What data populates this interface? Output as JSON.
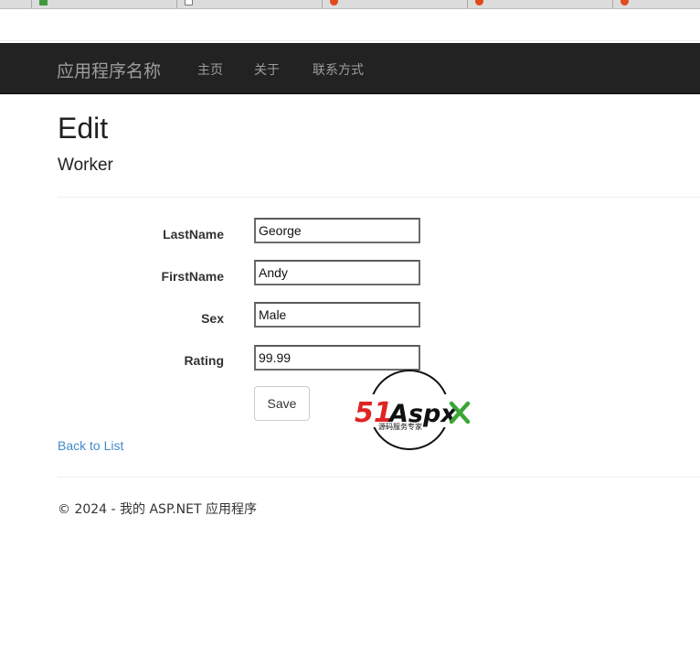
{
  "navbar": {
    "brand": "应用程序名称",
    "links": [
      "主页",
      "关于",
      "联系方式"
    ]
  },
  "page": {
    "title": "Edit",
    "subtitle": "Worker"
  },
  "form": {
    "fields": [
      {
        "label": "LastName",
        "value": "George"
      },
      {
        "label": "FirstName",
        "value": "Andy"
      },
      {
        "label": "Sex",
        "value": "Male"
      },
      {
        "label": "Rating",
        "value": "99.99"
      }
    ],
    "save_label": "Save"
  },
  "back_link": "Back to List",
  "footer": "© 2024 - 我的 ASP.NET 应用程序",
  "watermark": {
    "brand_51": "51",
    "brand_aspx": "Aspx",
    "tagline": "源码服务专家"
  },
  "colors": {
    "navbar_bg": "#222222",
    "nav_text": "#9d9d9d",
    "link": "#428bca",
    "watermark_red": "#e02424",
    "watermark_green": "#3aa635"
  }
}
